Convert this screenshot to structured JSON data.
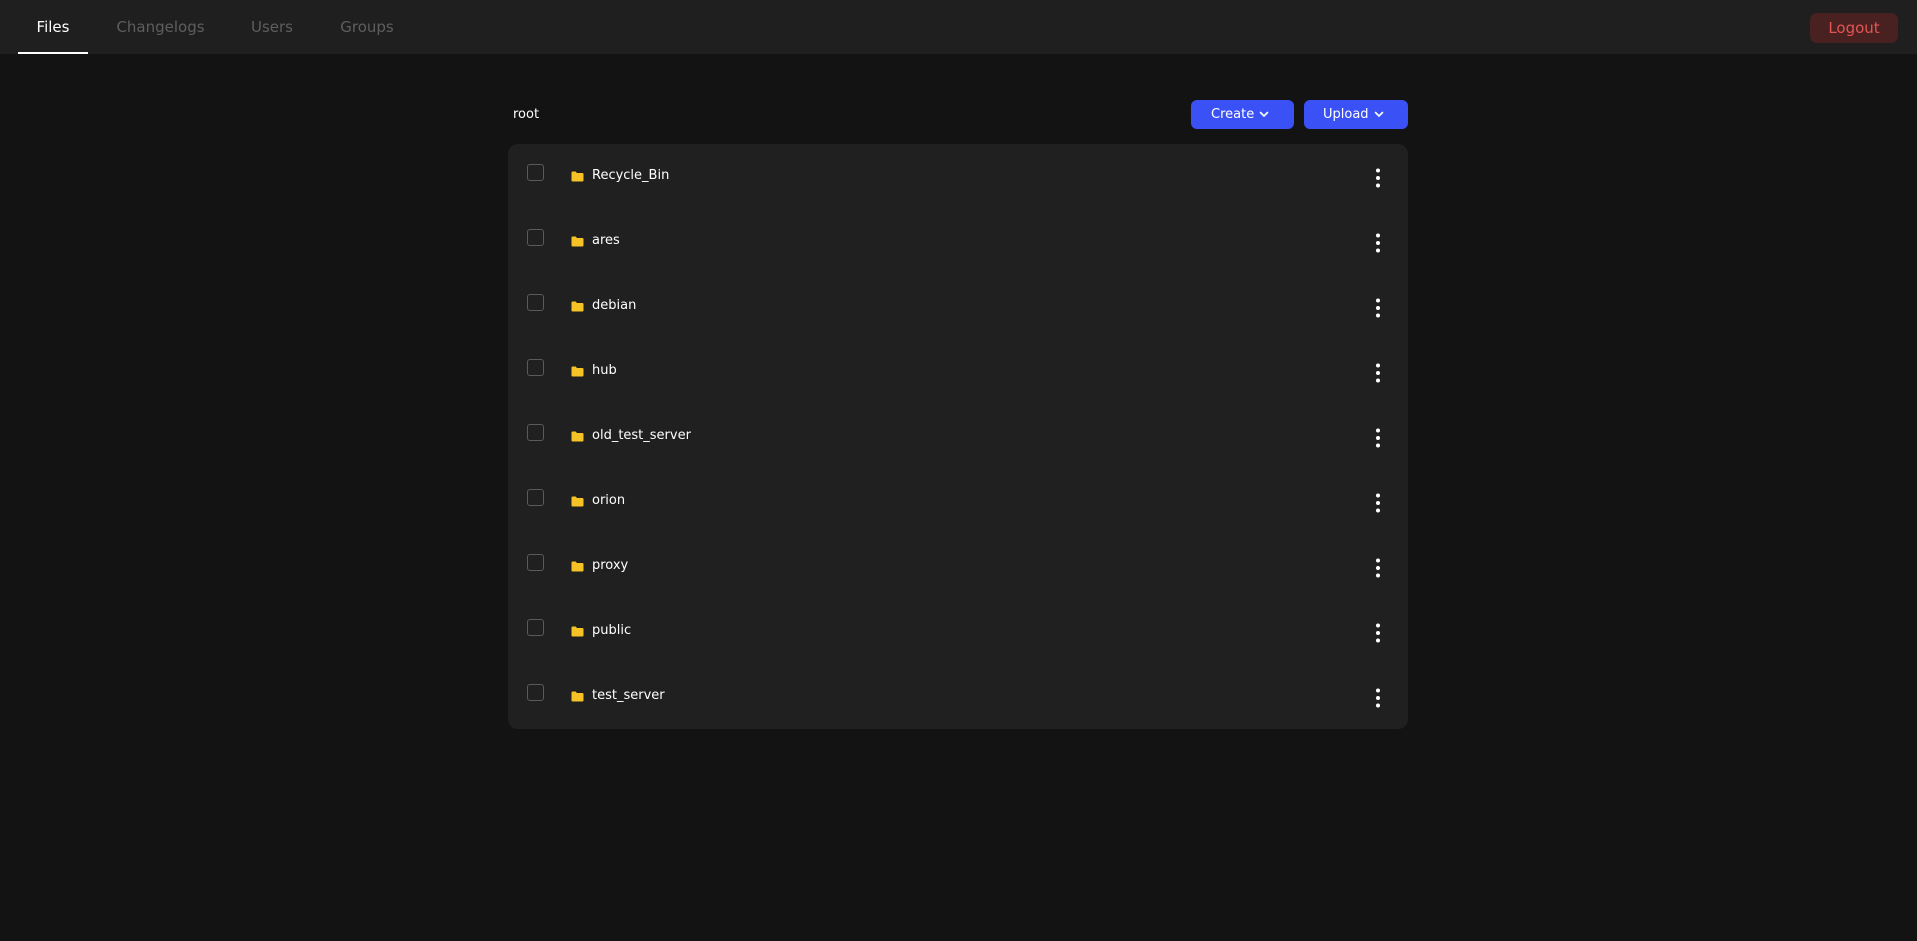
{
  "nav": {
    "tabs": [
      {
        "label": "Files",
        "active": true
      },
      {
        "label": "Changelogs",
        "active": false
      },
      {
        "label": "Users",
        "active": false
      },
      {
        "label": "Groups",
        "active": false
      }
    ],
    "logout_label": "Logout"
  },
  "breadcrumb": "root",
  "toolbar": {
    "create_label": "Create",
    "upload_label": "Upload",
    "create_icon": "chevron-down-icon",
    "upload_icon": "chevron-down-icon"
  },
  "files": [
    {
      "name": "Recycle_Bin",
      "type": "folder"
    },
    {
      "name": "ares",
      "type": "folder"
    },
    {
      "name": "debian",
      "type": "folder"
    },
    {
      "name": "hub",
      "type": "folder"
    },
    {
      "name": "old_test_server",
      "type": "folder"
    },
    {
      "name": "orion",
      "type": "folder"
    },
    {
      "name": "proxy",
      "type": "folder"
    },
    {
      "name": "public",
      "type": "folder"
    },
    {
      "name": "test_server",
      "type": "folder"
    }
  ],
  "colors": {
    "background": "#131313",
    "topbar": "#1f1f1f",
    "panel": "#202020",
    "accent": "#3a52f5",
    "folder": "#f5c326",
    "logout_bg": "#4a2121",
    "logout_text": "#e45454"
  }
}
